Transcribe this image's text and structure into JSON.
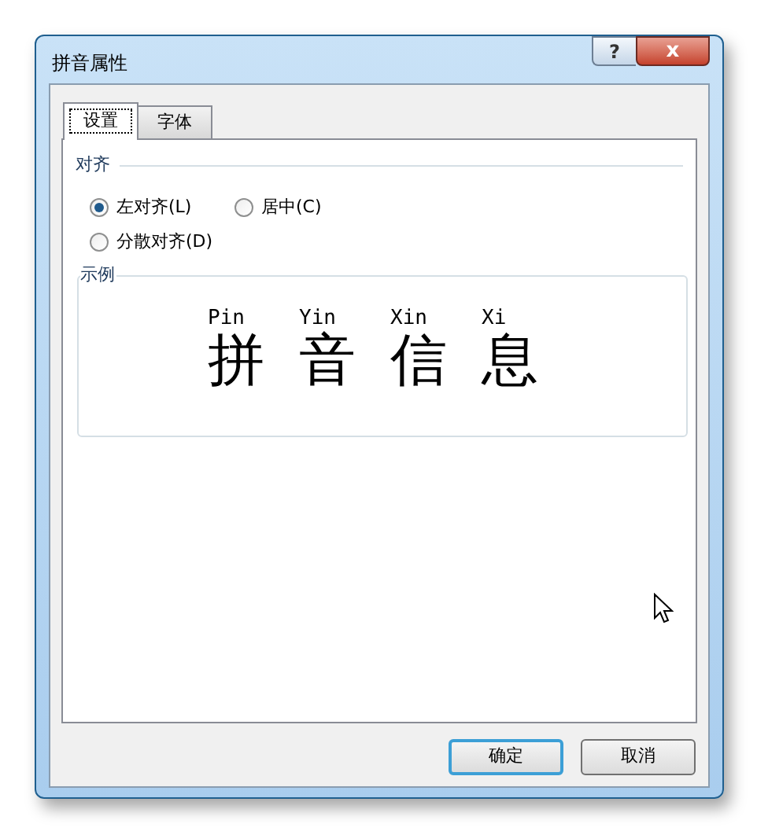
{
  "window": {
    "title": "拼音属性",
    "buttons": [
      {
        "kind": "help",
        "label": "?"
      },
      {
        "kind": "close",
        "label": "x"
      }
    ]
  },
  "tabs": [
    {
      "label": "设置",
      "selected": true
    },
    {
      "label": "字体",
      "selected": false
    }
  ],
  "alignment": {
    "title": "对齐",
    "options": [
      {
        "label": "左对齐(L)",
        "selected": true
      },
      {
        "label": "居中(C)",
        "selected": false
      },
      {
        "label": "分散对齐(D)",
        "selected": false
      }
    ]
  },
  "sample": {
    "title": "示例",
    "items": [
      {
        "pinyin": "Pin",
        "hanzi": "拼"
      },
      {
        "pinyin": "Yin",
        "hanzi": "音"
      },
      {
        "pinyin": "Xin",
        "hanzi": "信"
      },
      {
        "pinyin": "Xi",
        "hanzi": "息"
      }
    ]
  },
  "buttons": [
    {
      "label": "确定",
      "default": true
    },
    {
      "label": "取消",
      "default": false
    }
  ]
}
